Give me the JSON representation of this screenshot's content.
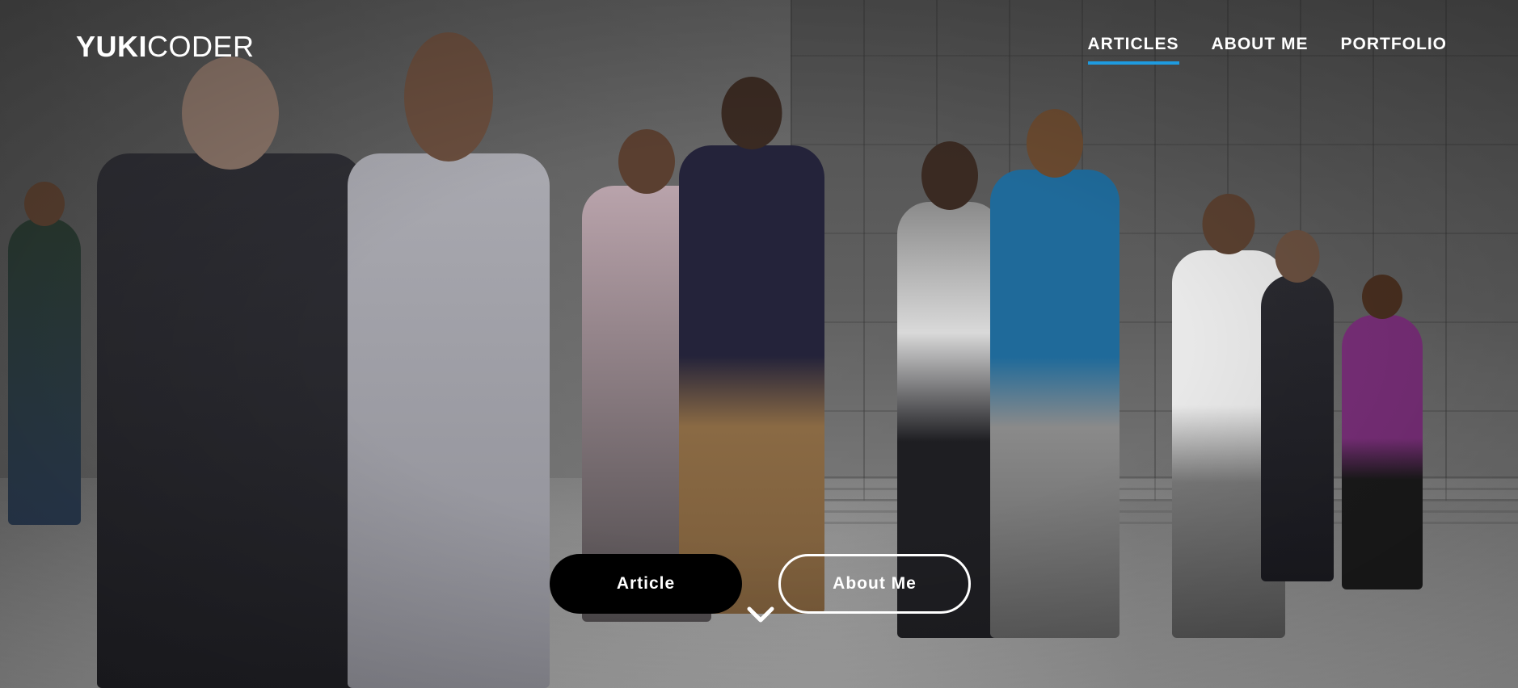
{
  "brand": {
    "logo_bold": "YUKI",
    "logo_light": "CODER"
  },
  "nav": {
    "items": [
      {
        "label": "ARTICLES",
        "active": true
      },
      {
        "label": "ABOUT ME",
        "active": false
      },
      {
        "label": "PORTFOLIO",
        "active": false
      }
    ]
  },
  "hero": {
    "primary_button": "Article",
    "secondary_button": "About Me",
    "scroll_icon": "chevron-down-icon"
  },
  "colors": {
    "accent": "#1e9be0",
    "primary_button_bg": "#000000",
    "text": "#ffffff"
  }
}
